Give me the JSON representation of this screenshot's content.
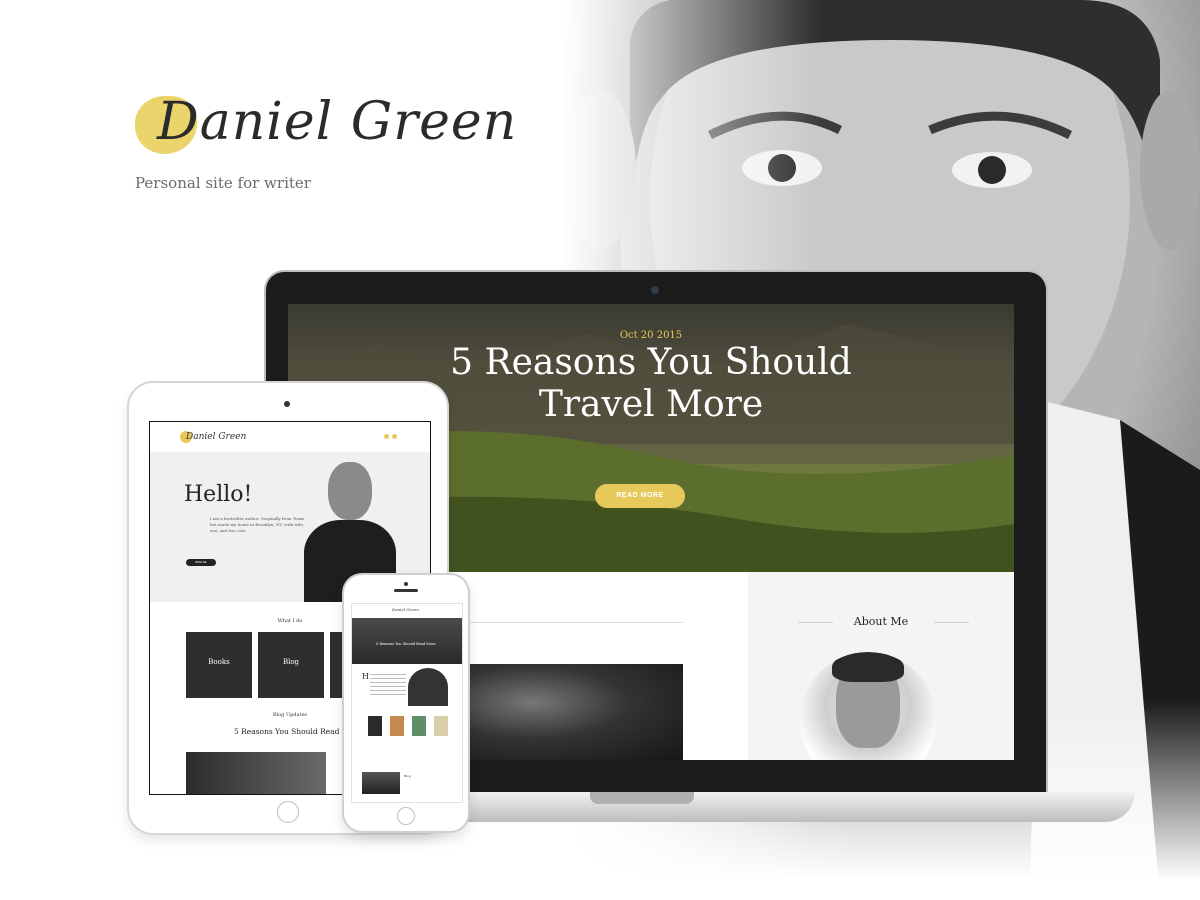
{
  "brand": {
    "logo_text": "Daniel Green",
    "tagline": "Personal site for writer"
  },
  "laptop": {
    "hero": {
      "date": "Oct 20 2015",
      "title": "5 Reasons You Should Travel More",
      "button_label": "READ MORE"
    },
    "sidebar": {
      "about_title": "About Me"
    }
  },
  "tablet": {
    "logo_text": "Daniel Green",
    "hello": "Hello!",
    "intro": "I am a bestseller author. Originally from Texas but made my home in Brooklyn, NY, with wife, son, and two cats.",
    "read_more": "READ ME",
    "what_i_do": "What I do",
    "cards": [
      {
        "label": "Books"
      },
      {
        "label": "Blog"
      }
    ],
    "blog_updates": "Blog Updates",
    "post_title": "5 Reasons You Should Read More"
  },
  "phone": {
    "logo_text": "Daniel Green",
    "hero_title": "5 Reasons You Should Read More",
    "hello_letter": "H",
    "blog_title": "Blog"
  },
  "colors": {
    "accent": "#e6c95a",
    "dark": "#1c1c1c"
  }
}
